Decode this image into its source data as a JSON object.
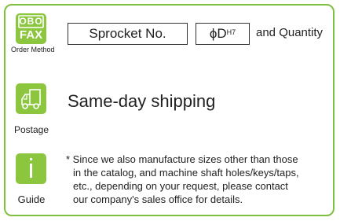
{
  "order_method": {
    "badge_top": "OBO",
    "badge_bottom": "FAX",
    "caption": "Order Method",
    "box1": "Sprocket No.",
    "box2_phi": "ϕD",
    "box2_sup": "H7",
    "suffix": "and Quantity"
  },
  "postage": {
    "caption": "Postage",
    "text": "Same-day shipping"
  },
  "guide": {
    "icon_char": "i",
    "caption": "Guide",
    "lines": [
      "* Since we also manufacture sizes other than those",
      "in the catalog, and machine shaft holes/keys/taps,",
      "etc., depending on your request, please contact",
      "our company's sales office for details."
    ]
  },
  "colors": {
    "border": "#7fc03e",
    "badge_fill": "#8cc63f"
  }
}
